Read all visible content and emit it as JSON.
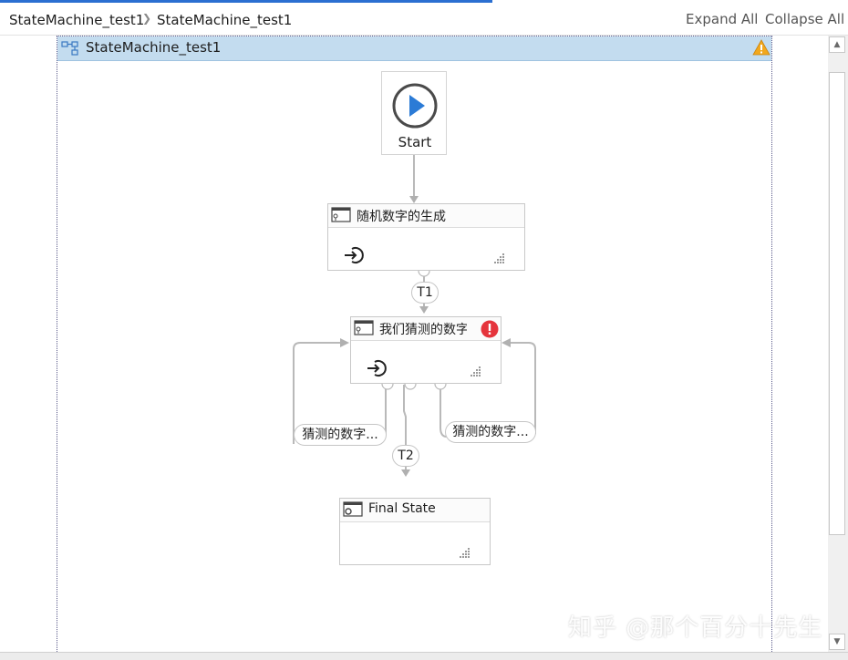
{
  "breadcrumb": {
    "items": [
      "StateMachine_test1",
      "StateMachine_test1"
    ],
    "separator": ">"
  },
  "header": {
    "expand_all": "Expand All",
    "collapse_all": "Collapse All"
  },
  "state_machine": {
    "title": "StateMachine_test1",
    "warning_icon": "warning-triangle-icon"
  },
  "start": {
    "label": "Start",
    "icon": "play-circle-icon"
  },
  "states": [
    {
      "title": "随机数字的生成",
      "icon": "state-icon",
      "entry_icon": "entry-arrow-icon"
    },
    {
      "title": "我们猜测的数字",
      "icon": "state-icon",
      "entry_icon": "entry-arrow-icon",
      "error": true
    },
    {
      "title": "Final State",
      "icon": "final-state-icon"
    }
  ],
  "transitions": [
    {
      "label": "T1"
    },
    {
      "label": "猜测的数字..."
    },
    {
      "label": "T2"
    },
    {
      "label": "猜测的数字..."
    }
  ],
  "watermark": "知乎 @那个百分十先生",
  "colors": {
    "accent": "#2b6fd1",
    "header_bg": "#c3dcef",
    "play": "#2b7bd6",
    "error": "#e5343c",
    "warning": "#f2a81d"
  }
}
